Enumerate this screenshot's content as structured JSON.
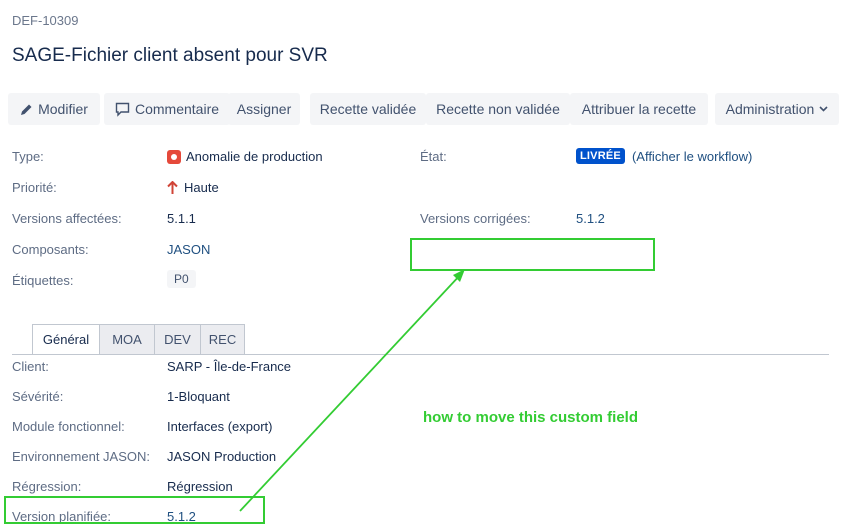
{
  "issue": {
    "key": "DEF-10309",
    "title": "SAGE-Fichier client absent pour SVR"
  },
  "toolbar": {
    "edit": "Modifier",
    "comment": "Commentaire",
    "assign": "Assigner",
    "recette_validee": "Recette validée",
    "recette_non_validee": "Recette non validée",
    "attribuer_recette": "Attribuer la recette",
    "administration": "Administration"
  },
  "details": {
    "type_label": "Type:",
    "type_value": "Anomalie de production",
    "priority_label": "Priorité:",
    "priority_value": "Haute",
    "affects_label": "Versions affectées:",
    "affects_value": "5.1.1",
    "components_label": "Composants:",
    "components_value": "JASON",
    "labels_label": "Étiquettes:",
    "labels_value": "P0",
    "status_label": "État:",
    "status_value": "LIVRÉE",
    "workflow_link": "(Afficher le workflow)",
    "fix_label": "Versions corrigées:",
    "fix_value": "5.1.2"
  },
  "tabs": [
    "Général",
    "MOA",
    "DEV",
    "REC"
  ],
  "general": {
    "client_label": "Client:",
    "client_value": "SARP - Île-de-France",
    "severity_label": "Sévérité:",
    "severity_value": "1-Bloquant",
    "module_label": "Module fonctionnel:",
    "module_value": "Interfaces (export)",
    "env_label": "Environnement JASON:",
    "env_value": "JASON Production",
    "regression_label": "Régression:",
    "regression_value": "Régression",
    "planned_label": "Version planifiée:",
    "planned_value": "5.1.2"
  },
  "annotation": {
    "text": "how to move this custom field",
    "color": "#33cc33"
  },
  "colors": {
    "status": "#0052cc",
    "link": "#205081",
    "priority": "#d04437",
    "type_icon": "#e5493a"
  }
}
